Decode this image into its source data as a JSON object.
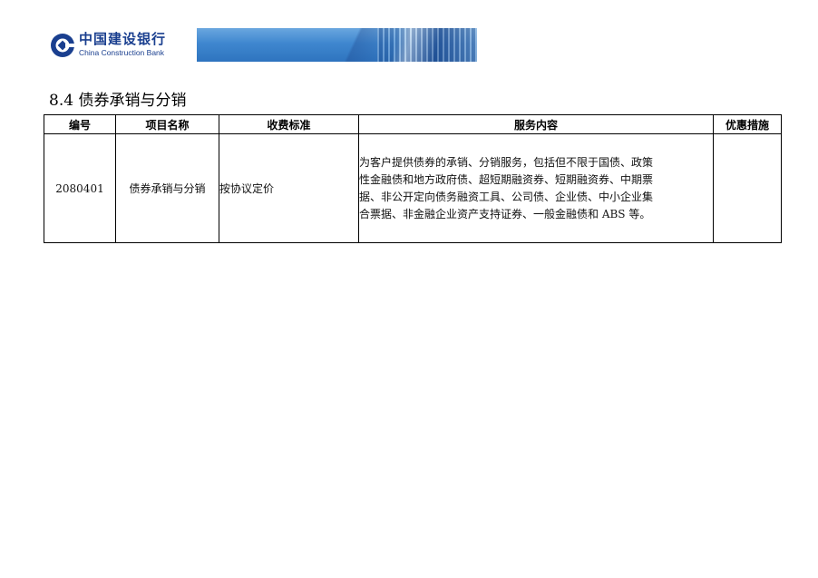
{
  "header": {
    "logo_cn": "中国建设银行",
    "logo_en": "China Construction Bank"
  },
  "section": {
    "title": "8.4 债券承销与分销"
  },
  "table": {
    "headers": [
      "编号",
      "项目名称",
      "收费标准",
      "服务内容",
      "优惠措施"
    ],
    "rows": [
      {
        "code": "2080401",
        "name": "债券承销与分销",
        "standard": "按协议定价",
        "content_lines": [
          "为客户提供债券的承销、分销服务，包括但不限于国债、政策",
          "性金融债和地方政府债、超短期融资券、短期融资券、中期票",
          "据、非公开定向债务融资工具、公司债、企业债、中小企业集",
          "合票据、非金融企业资产支持证券、一般金融债和 ABS 等。"
        ],
        "discount": ""
      }
    ]
  },
  "colors": {
    "brand_blue": "#1a3f8f",
    "banner_blue": "#3f87cf"
  }
}
